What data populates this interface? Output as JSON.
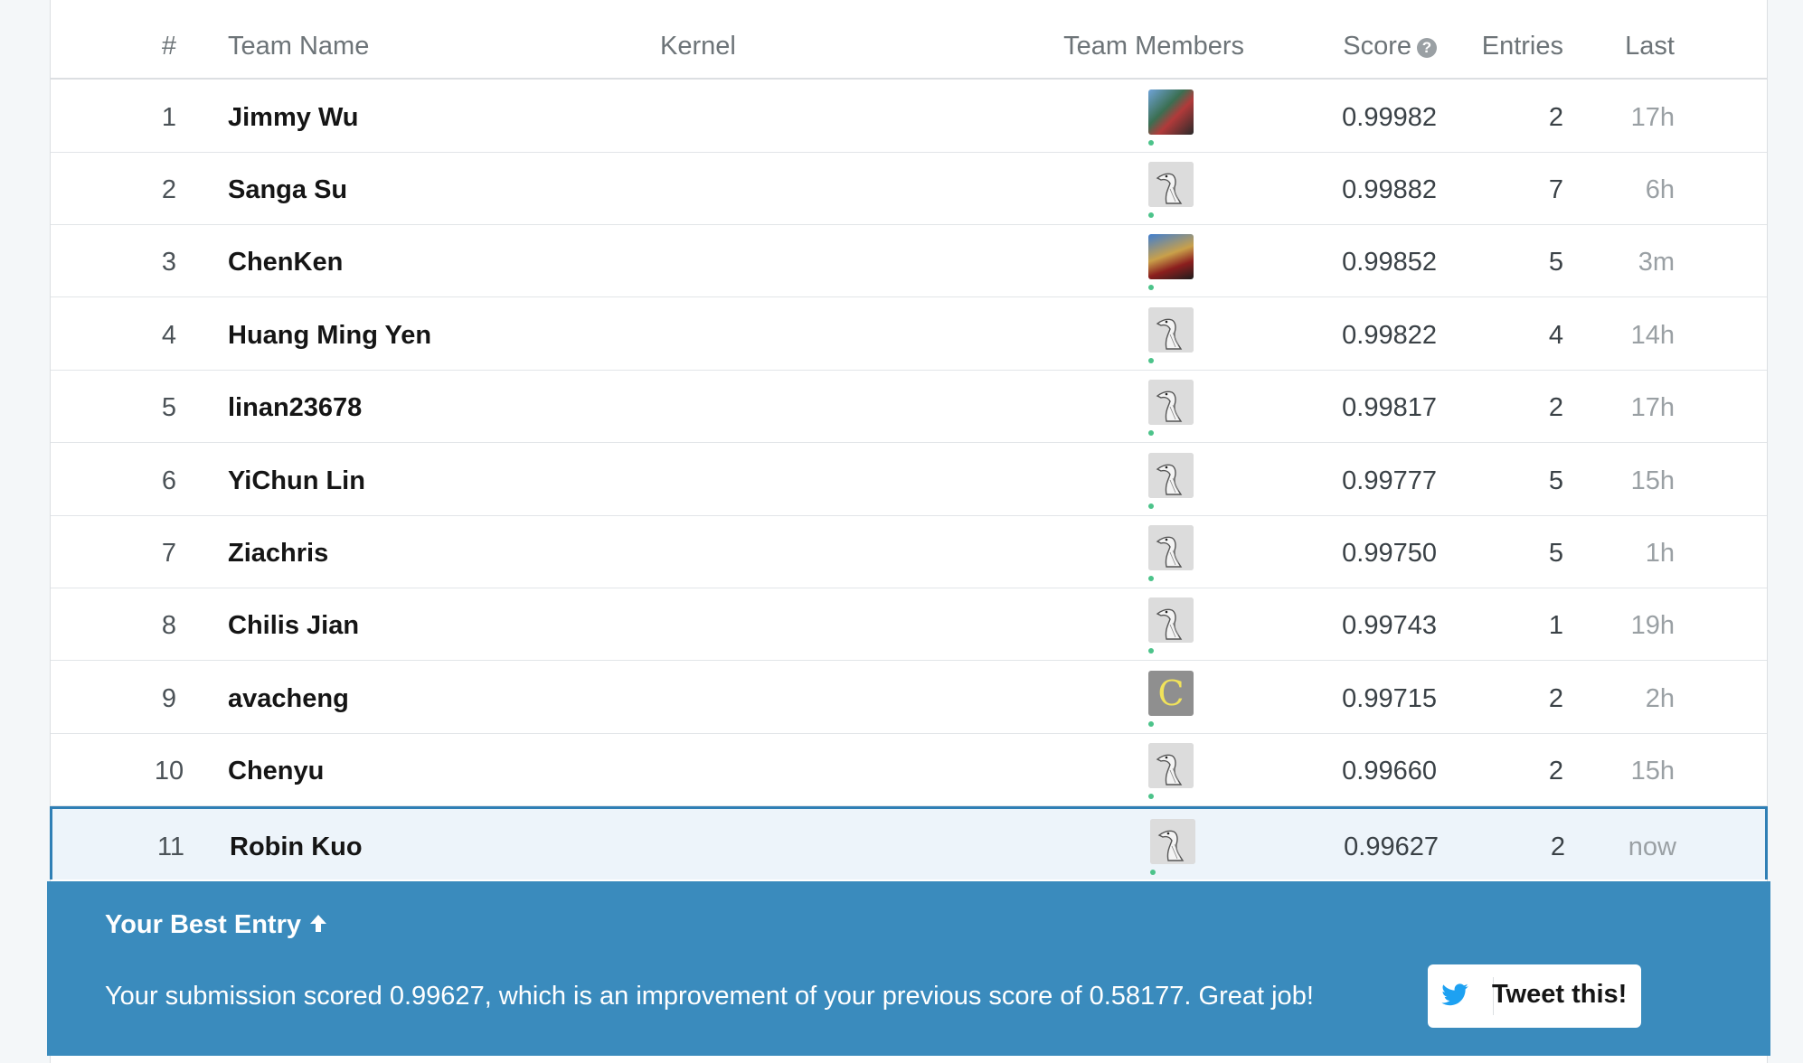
{
  "headers": {
    "rank": "#",
    "team_name": "Team Name",
    "kernel": "Kernel",
    "team_members": "Team Members",
    "score": "Score",
    "entries": "Entries",
    "last": "Last"
  },
  "rows": [
    {
      "rank": "1",
      "name": "Jimmy Wu",
      "avatar": "photo-avatar",
      "score": "0.99982",
      "entries": "2",
      "last": "17h"
    },
    {
      "rank": "2",
      "name": "Sanga Su",
      "avatar": "goose-avatar",
      "score": "0.99882",
      "entries": "7",
      "last": "6h"
    },
    {
      "rank": "3",
      "name": "ChenKen",
      "avatar": "photo-avatar",
      "score": "0.99852",
      "entries": "5",
      "last": "3m"
    },
    {
      "rank": "4",
      "name": "Huang Ming Yen",
      "avatar": "goose-avatar",
      "score": "0.99822",
      "entries": "4",
      "last": "14h"
    },
    {
      "rank": "5",
      "name": "linan23678",
      "avatar": "goose-avatar",
      "score": "0.99817",
      "entries": "2",
      "last": "17h"
    },
    {
      "rank": "6",
      "name": "YiChun Lin",
      "avatar": "goose-avatar",
      "score": "0.99777",
      "entries": "5",
      "last": "15h"
    },
    {
      "rank": "7",
      "name": "Ziachris",
      "avatar": "goose-avatar",
      "score": "0.99750",
      "entries": "5",
      "last": "1h"
    },
    {
      "rank": "8",
      "name": "Chilis Jian",
      "avatar": "goose-avatar",
      "score": "0.99743",
      "entries": "1",
      "last": "19h"
    },
    {
      "rank": "9",
      "name": "avacheng",
      "avatar": "letter-avatar",
      "avatar_letter": "C",
      "score": "0.99715",
      "entries": "2",
      "last": "2h"
    },
    {
      "rank": "10",
      "name": "Chenyu",
      "avatar": "goose-avatar",
      "score": "0.99660",
      "entries": "2",
      "last": "15h"
    },
    {
      "rank": "11",
      "name": "Robin Kuo",
      "avatar": "goose-avatar",
      "score": "0.99627",
      "entries": "2",
      "last": "now"
    }
  ],
  "best_entry": {
    "title": "Your Best Entry",
    "message": "Your submission scored 0.99627, which is an improvement of your previous score of 0.58177. Great job!",
    "tweet_label": "Tweet this!"
  },
  "colors": {
    "banner": "#3a8bbd",
    "highlight_border": "#2f7fb5",
    "online_dot": "#4cc38a",
    "twitter_blue": "#1da1f2"
  }
}
